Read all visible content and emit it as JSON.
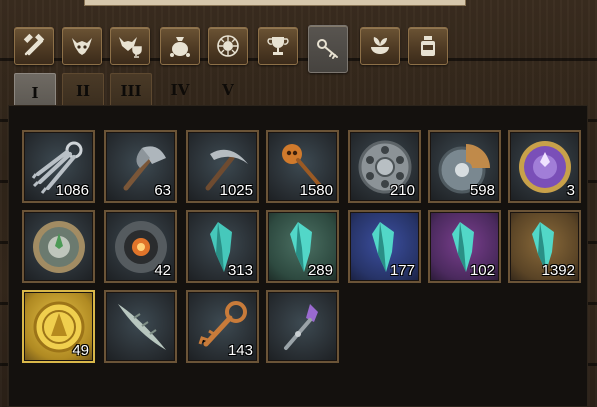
{
  "category_tabs": [
    {
      "icon": "crossed-tools-icon",
      "active": false
    },
    {
      "icon": "demon-skull-icon",
      "active": false
    },
    {
      "icon": "demon-trophy-icon",
      "active": false
    },
    {
      "icon": "money-bag-icon",
      "active": false
    },
    {
      "icon": "sun-medallion-icon",
      "active": false
    },
    {
      "icon": "trophy-icon",
      "active": false
    },
    {
      "icon": "key-icon",
      "active": true
    },
    {
      "icon": "herb-bowl-icon",
      "active": false
    },
    {
      "icon": "potion-jar-icon",
      "active": false
    }
  ],
  "page_tabs": [
    "I",
    "II",
    "III",
    "IV",
    "V"
  ],
  "active_page": "I",
  "items": [
    {
      "name": "key-ring",
      "count": "1086"
    },
    {
      "name": "hatchet",
      "count": "63"
    },
    {
      "name": "pickaxe",
      "count": "1025"
    },
    {
      "name": "skull-scepter",
      "count": "1580"
    },
    {
      "name": "steel-cylinder-lock",
      "count": "210"
    },
    {
      "name": "bronze-gear-lock",
      "count": "598"
    },
    {
      "name": "purple-seal-lock",
      "count": "3"
    },
    {
      "name": "jade-seal-lock",
      "count": ""
    },
    {
      "name": "ember-seal-lock",
      "count": "42"
    },
    {
      "name": "cyan-crystal-shard",
      "count": "313"
    },
    {
      "name": "cyan-crystal-shard-green",
      "count": "289"
    },
    {
      "name": "cyan-crystal-shard-blue",
      "count": "177"
    },
    {
      "name": "cyan-crystal-shard-purple",
      "count": "102"
    },
    {
      "name": "cyan-crystal-shard-gold",
      "count": "1392"
    },
    {
      "name": "gold-coin",
      "count": "49"
    },
    {
      "name": "bone-blade",
      "count": ""
    },
    {
      "name": "ornate-key",
      "count": "143"
    },
    {
      "name": "amethyst-scepter",
      "count": ""
    }
  ],
  "colors": {
    "slot_border": "#6b5437",
    "tab_wood": "#5a442b",
    "crystal": "#52d7c8"
  }
}
